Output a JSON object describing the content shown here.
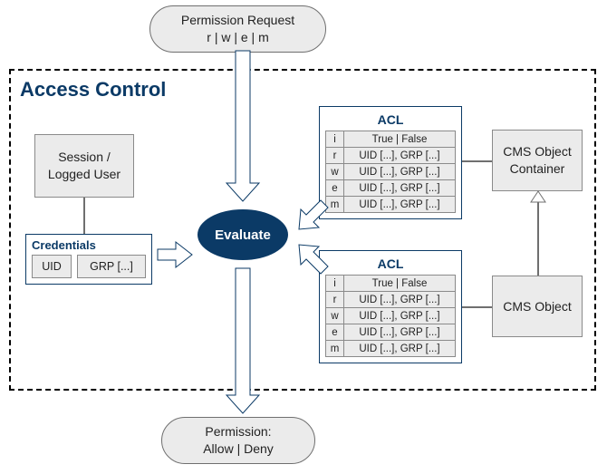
{
  "permission_request": {
    "title": "Permission Request",
    "flags": "r | w | e | m"
  },
  "frame_title": "Access Control",
  "session_box": "Session /\nLogged User",
  "credentials": {
    "title": "Credentials",
    "uid": "UID",
    "grp": "GRP [...]"
  },
  "evaluate": "Evaluate",
  "acl1": {
    "title": "ACL",
    "rows": [
      {
        "k": "i",
        "v": "True | False"
      },
      {
        "k": "r",
        "v": "UID [...], GRP [...]"
      },
      {
        "k": "w",
        "v": "UID [...], GRP [...]"
      },
      {
        "k": "e",
        "v": "UID [...], GRP [...]"
      },
      {
        "k": "m",
        "v": "UID [...], GRP [...]"
      }
    ]
  },
  "acl2": {
    "title": "ACL",
    "rows": [
      {
        "k": "i",
        "v": "True | False"
      },
      {
        "k": "r",
        "v": "UID [...], GRP [...]"
      },
      {
        "k": "w",
        "v": "UID [...], GRP [...]"
      },
      {
        "k": "e",
        "v": "UID [...], GRP [...]"
      },
      {
        "k": "m",
        "v": "UID [...], GRP [...]"
      }
    ]
  },
  "cms_container": "CMS Object\nContainer",
  "cms_object": "CMS Object",
  "result": {
    "title": "Permission:",
    "value": "Allow | Deny"
  }
}
